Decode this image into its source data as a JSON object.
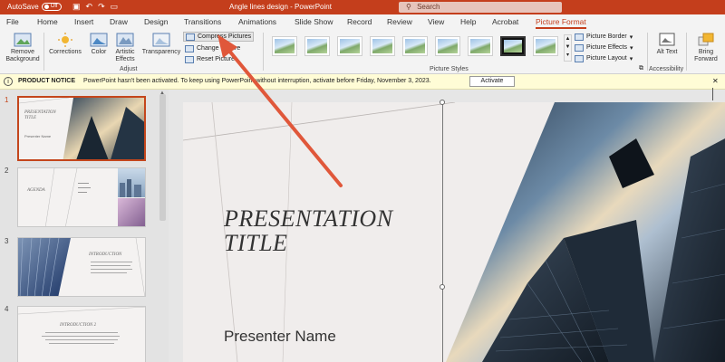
{
  "titlebar": {
    "autosave_label": "AutoSave",
    "autosave_state": "Off",
    "doc_title": "Angle lines design  -  PowerPoint",
    "search_placeholder": "Search"
  },
  "tabs": [
    "File",
    "Home",
    "Insert",
    "Draw",
    "Design",
    "Transitions",
    "Animations",
    "Slide Show",
    "Record",
    "Review",
    "View",
    "Help",
    "Acrobat",
    "Picture Format"
  ],
  "active_tab": "Picture Format",
  "ribbon": {
    "remove_bg": "Remove Background",
    "corrections": "Corrections",
    "color": "Color",
    "artistic": "Artistic Effects",
    "transparency": "Transparency",
    "compress": "Compress Pictures",
    "change": "Change Picture",
    "reset": "Reset Picture",
    "adjust_label": "Adjust",
    "picture_styles_label": "Picture Styles",
    "border": "Picture Border",
    "effects": "Picture Effects",
    "layout": "Picture Layout",
    "alt_text": "Alt Text",
    "accessibility_label": "Accessibility",
    "bring_forward": "Bring Forward"
  },
  "notice": {
    "title": "PRODUCT NOTICE",
    "message": "PowerPoint hasn't been activated. To keep using PowerPoint without interruption, activate before Friday, November 3, 2023.",
    "button": "Activate"
  },
  "slides": [
    {
      "num": "1",
      "title": "PRESENTATION TITLE",
      "sub": "Presenter Name"
    },
    {
      "num": "2",
      "title": "AGENDA"
    },
    {
      "num": "3",
      "title": "INTRODUCTION"
    },
    {
      "num": "4",
      "title": "INTRODUCTION 2"
    }
  ],
  "main_slide": {
    "title_line1": "PRESENTATION",
    "title_line2": "TITLE",
    "presenter": "Presenter Name"
  },
  "colors": {
    "accent": "#c43e1c",
    "arrow": "#e0573a",
    "notice_bg": "#fffcd6"
  }
}
